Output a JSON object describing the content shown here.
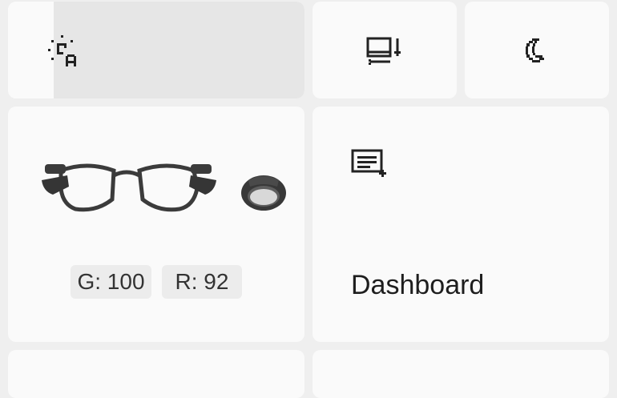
{
  "quick_settings": {
    "brightness": {
      "icon": "auto-brightness-icon",
      "level": 0.16
    },
    "display": {
      "icon": "display-sync-icon"
    },
    "night_mode": {
      "icon": "moon-icon"
    }
  },
  "devices": {
    "glasses": {
      "label": "G: 100"
    },
    "ring": {
      "label": "R: 92"
    }
  },
  "dashboard": {
    "icon": "dashboard-list-icon",
    "label": "Dashboard"
  }
}
